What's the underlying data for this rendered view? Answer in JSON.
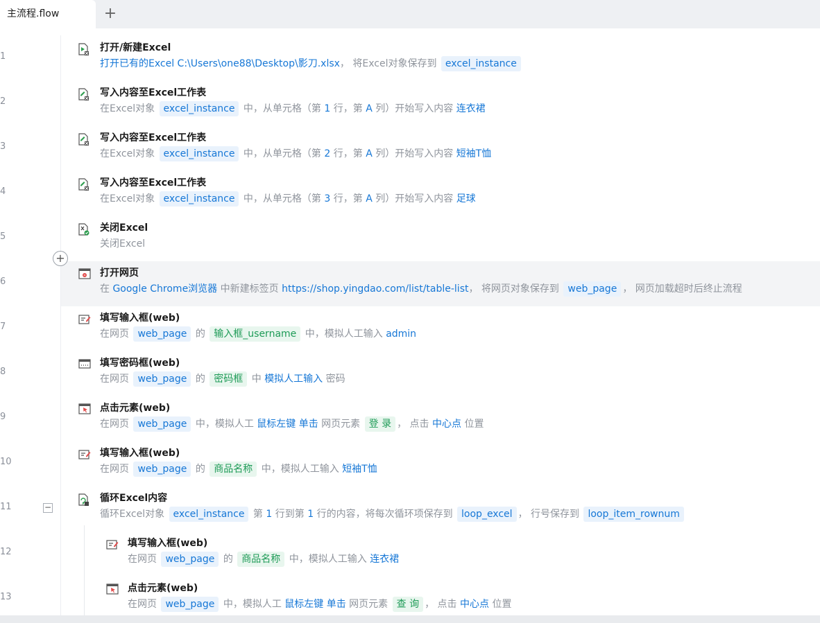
{
  "tabs": {
    "active_label": "主流程.flow",
    "add_label": "+"
  },
  "steps": [
    {
      "no": "1",
      "title": "打开/新建Excel",
      "icon": "excel-open-icon",
      "desc": [
        {
          "k": "v",
          "s": "打开已有的Excel"
        },
        {
          "k": "t",
          "s": "  "
        },
        {
          "k": "v",
          "s": "C:\\Users\\one88\\Desktop\\影刀.xlsx"
        },
        {
          "k": "t",
          "s": "， 将Excel对象保存到 "
        },
        {
          "k": "chip",
          "s": "excel_instance"
        }
      ]
    },
    {
      "no": "2",
      "title": "写入内容至Excel工作表",
      "icon": "excel-write-icon",
      "desc": [
        {
          "k": "t",
          "s": "在Excel对象 "
        },
        {
          "k": "chip",
          "s": "excel_instance"
        },
        {
          "k": "t",
          "s": " 中，从单元格（第 "
        },
        {
          "k": "v",
          "s": "1"
        },
        {
          "k": "t",
          "s": " 行，第 "
        },
        {
          "k": "v",
          "s": "A"
        },
        {
          "k": "t",
          "s": " 列）开始写入内容 "
        },
        {
          "k": "v",
          "s": "连衣裙"
        }
      ]
    },
    {
      "no": "3",
      "title": "写入内容至Excel工作表",
      "icon": "excel-write-icon",
      "desc": [
        {
          "k": "t",
          "s": "在Excel对象 "
        },
        {
          "k": "chip",
          "s": "excel_instance"
        },
        {
          "k": "t",
          "s": " 中，从单元格（第 "
        },
        {
          "k": "v",
          "s": "2"
        },
        {
          "k": "t",
          "s": " 行，第 "
        },
        {
          "k": "v",
          "s": "A"
        },
        {
          "k": "t",
          "s": " 列）开始写入内容 "
        },
        {
          "k": "v",
          "s": "短袖T恤"
        }
      ]
    },
    {
      "no": "4",
      "title": "写入内容至Excel工作表",
      "icon": "excel-write-icon",
      "desc": [
        {
          "k": "t",
          "s": "在Excel对象 "
        },
        {
          "k": "chip",
          "s": "excel_instance"
        },
        {
          "k": "t",
          "s": " 中，从单元格（第 "
        },
        {
          "k": "v",
          "s": "3"
        },
        {
          "k": "t",
          "s": " 行，第 "
        },
        {
          "k": "v",
          "s": "A"
        },
        {
          "k": "t",
          "s": " 列）开始写入内容 "
        },
        {
          "k": "v",
          "s": "足球"
        }
      ]
    },
    {
      "no": "5",
      "title": "关闭Excel",
      "icon": "excel-close-icon",
      "desc": [
        {
          "k": "t",
          "s": "关闭Excel"
        }
      ]
    },
    {
      "no": "6",
      "title": "打开网页",
      "icon": "browser-open-icon",
      "selected": true,
      "desc": [
        {
          "k": "t",
          "s": "在 "
        },
        {
          "k": "v",
          "s": "Google Chrome浏览器"
        },
        {
          "k": "t",
          "s": " 中新建标签页  "
        },
        {
          "k": "v",
          "s": "https://shop.yingdao.com/list/table-list"
        },
        {
          "k": "t",
          "s": "， 将网页对象保存到 "
        },
        {
          "k": "chip",
          "s": "web_page"
        },
        {
          "k": "t",
          "s": "， 网页加载超时后终止流程"
        }
      ]
    },
    {
      "no": "7",
      "title": "填写输入框(web)",
      "icon": "input-fill-icon",
      "desc": [
        {
          "k": "t",
          "s": "在网页 "
        },
        {
          "k": "chip",
          "s": "web_page"
        },
        {
          "k": "t",
          "s": " 的 "
        },
        {
          "k": "chipel",
          "s": "输入框_username"
        },
        {
          "k": "t",
          "s": " 中，模拟人工输入 "
        },
        {
          "k": "v",
          "s": "admin"
        }
      ]
    },
    {
      "no": "8",
      "title": "填写密码框(web)",
      "icon": "password-fill-icon",
      "desc": [
        {
          "k": "t",
          "s": "在网页 "
        },
        {
          "k": "chip",
          "s": "web_page"
        },
        {
          "k": "t",
          "s": " 的 "
        },
        {
          "k": "chipel",
          "s": "密码框"
        },
        {
          "k": "t",
          "s": " 中 "
        },
        {
          "k": "v",
          "s": "模拟人工输入"
        },
        {
          "k": "t",
          "s": " 密码"
        }
      ]
    },
    {
      "no": "9",
      "title": "点击元素(web)",
      "icon": "click-element-icon",
      "desc": [
        {
          "k": "t",
          "s": "在网页 "
        },
        {
          "k": "chip",
          "s": "web_page"
        },
        {
          "k": "t",
          "s": " 中，模拟人工 "
        },
        {
          "k": "v",
          "s": "鼠标左键"
        },
        {
          "k": "t",
          "s": " "
        },
        {
          "k": "v",
          "s": "单击"
        },
        {
          "k": "t",
          "s": " 网页元素 "
        },
        {
          "k": "chipel",
          "s": "登 录"
        },
        {
          "k": "t",
          "s": "， 点击 "
        },
        {
          "k": "v",
          "s": "中心点"
        },
        {
          "k": "t",
          "s": " 位置"
        }
      ]
    },
    {
      "no": "10",
      "title": "填写输入框(web)",
      "icon": "input-fill-icon",
      "desc": [
        {
          "k": "t",
          "s": "在网页 "
        },
        {
          "k": "chip",
          "s": "web_page"
        },
        {
          "k": "t",
          "s": " 的 "
        },
        {
          "k": "chipel",
          "s": "商品名称"
        },
        {
          "k": "t",
          "s": " 中，模拟人工输入 "
        },
        {
          "k": "v",
          "s": "短袖T恤"
        }
      ]
    },
    {
      "no": "11",
      "title": "循环Excel内容",
      "icon": "loop-excel-icon",
      "collapse": "−",
      "desc": [
        {
          "k": "t",
          "s": "循环Excel对象 "
        },
        {
          "k": "chip",
          "s": "excel_instance"
        },
        {
          "k": "t",
          "s": " 第 "
        },
        {
          "k": "v",
          "s": "1"
        },
        {
          "k": "t",
          "s": " 行到第 "
        },
        {
          "k": "v",
          "s": "1"
        },
        {
          "k": "t",
          "s": " 行的内容，将每次循环项保存到 "
        },
        {
          "k": "chip",
          "s": "loop_excel"
        },
        {
          "k": "t",
          "s": "， 行号保存到 "
        },
        {
          "k": "chip",
          "s": "loop_item_rownum"
        }
      ]
    },
    {
      "no": "12",
      "title": "填写输入框(web)",
      "icon": "input-fill-icon",
      "indent": true,
      "desc": [
        {
          "k": "t",
          "s": "在网页 "
        },
        {
          "k": "chip",
          "s": "web_page"
        },
        {
          "k": "t",
          "s": " 的 "
        },
        {
          "k": "chipel",
          "s": "商品名称"
        },
        {
          "k": "t",
          "s": " 中，模拟人工输入 "
        },
        {
          "k": "v",
          "s": "连衣裙"
        }
      ]
    },
    {
      "no": "13",
      "title": "点击元素(web)",
      "icon": "click-element-icon",
      "indent": true,
      "desc": [
        {
          "k": "t",
          "s": "在网页 "
        },
        {
          "k": "chip",
          "s": "web_page"
        },
        {
          "k": "t",
          "s": " 中，模拟人工 "
        },
        {
          "k": "v",
          "s": "鼠标左键"
        },
        {
          "k": "t",
          "s": " "
        },
        {
          "k": "v",
          "s": "单击"
        },
        {
          "k": "t",
          "s": " 网页元素 "
        },
        {
          "k": "chipel",
          "s": "查 询"
        },
        {
          "k": "t",
          "s": "， 点击 "
        },
        {
          "k": "v",
          "s": "中心点"
        },
        {
          "k": "t",
          "s": " 位置"
        }
      ]
    }
  ],
  "add_step_label": "+"
}
